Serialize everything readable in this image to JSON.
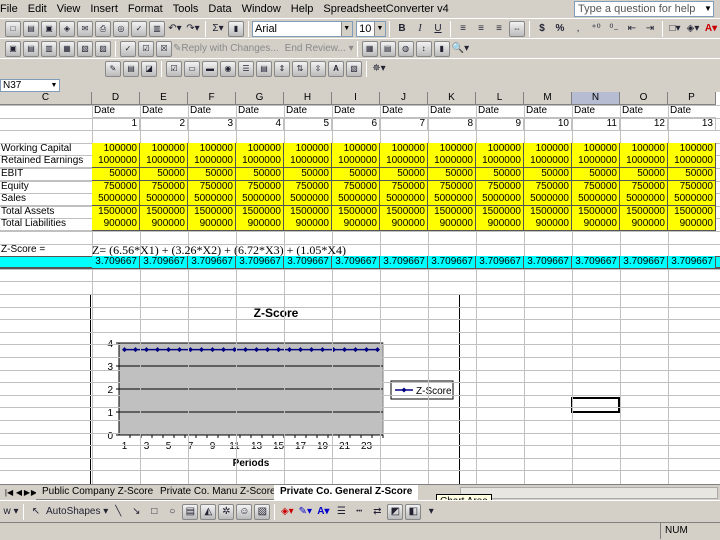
{
  "menu": [
    "File",
    "Edit",
    "View",
    "Insert",
    "Format",
    "Tools",
    "Data",
    "Window",
    "Help",
    "SpreadsheetConverter v4"
  ],
  "help_placeholder": "Type a question for help",
  "toolbar": {
    "font_name": "Arial",
    "font_size": "10",
    "bold": "B",
    "italic": "I",
    "underline": "U",
    "sigma": "Σ",
    "currency": "$",
    "percent": "%",
    "reply_with_changes": "Reply with Changes...",
    "end_review": "End Review...",
    "text_a": "A"
  },
  "namebox": "N37",
  "columns": [
    "C",
    "D",
    "E",
    "F",
    "G",
    "H",
    "I",
    "J",
    "K",
    "L",
    "M",
    "N",
    "O",
    "P"
  ],
  "active_column": "N",
  "header_row": {
    "label": "Date",
    "periods": [
      1,
      2,
      3,
      4,
      5,
      6,
      7,
      8,
      9,
      10,
      11,
      12,
      13
    ]
  },
  "inputs": [
    {
      "label": "Working Capital",
      "value": "100000"
    },
    {
      "label": "Retained Earnings",
      "value": "1000000"
    },
    {
      "label": "EBIT",
      "value": "50000"
    },
    {
      "label": "Equity",
      "value": "750000"
    },
    {
      "label": "Sales",
      "value": "5000000"
    },
    {
      "label": "Total Assets",
      "value": "1500000"
    },
    {
      "label": "Total Liabilities",
      "value": "900000"
    }
  ],
  "zscore": {
    "label": "Z-Score =",
    "formula": "Z= (6.56*X1) + (3.26*X2) + (6.72*X3) + (1.05*X4)",
    "value": "3.709667"
  },
  "chart_data": {
    "type": "line",
    "title": "Z-Score",
    "xlabel": "Periods",
    "ylabel": "",
    "ylim": [
      0,
      4
    ],
    "yticks": [
      0,
      1,
      2,
      3,
      4
    ],
    "xticks": [
      1,
      3,
      5,
      7,
      9,
      11,
      13,
      15,
      17,
      19,
      21,
      23
    ],
    "x": [
      1,
      2,
      3,
      4,
      5,
      6,
      7,
      8,
      9,
      10,
      11,
      12,
      13,
      14,
      15,
      16,
      17,
      18,
      19,
      20,
      21,
      22,
      23,
      24
    ],
    "series": [
      {
        "name": "Z-Score",
        "values": [
          3.709667,
          3.709667,
          3.709667,
          3.709667,
          3.709667,
          3.709667,
          3.709667,
          3.709667,
          3.709667,
          3.709667,
          3.709667,
          3.709667,
          3.709667,
          3.709667,
          3.709667,
          3.709667,
          3.709667,
          3.709667,
          3.709667,
          3.709667,
          3.709667,
          3.709667,
          3.709667,
          3.709667
        ],
        "color": "#000080"
      }
    ],
    "plot_bg": "#c0c0c0",
    "grid": true,
    "legend": "right"
  },
  "sheet_tabs": [
    "Public Company Z-Score",
    "Private Co. Manu Z-Score",
    "Private Co. General Z-Score"
  ],
  "active_tab": 2,
  "tooltip": "Chart Area",
  "drawbar": {
    "draw_label": "w",
    "autoshapes": "AutoShapes"
  },
  "status": {
    "num": "NUM"
  }
}
